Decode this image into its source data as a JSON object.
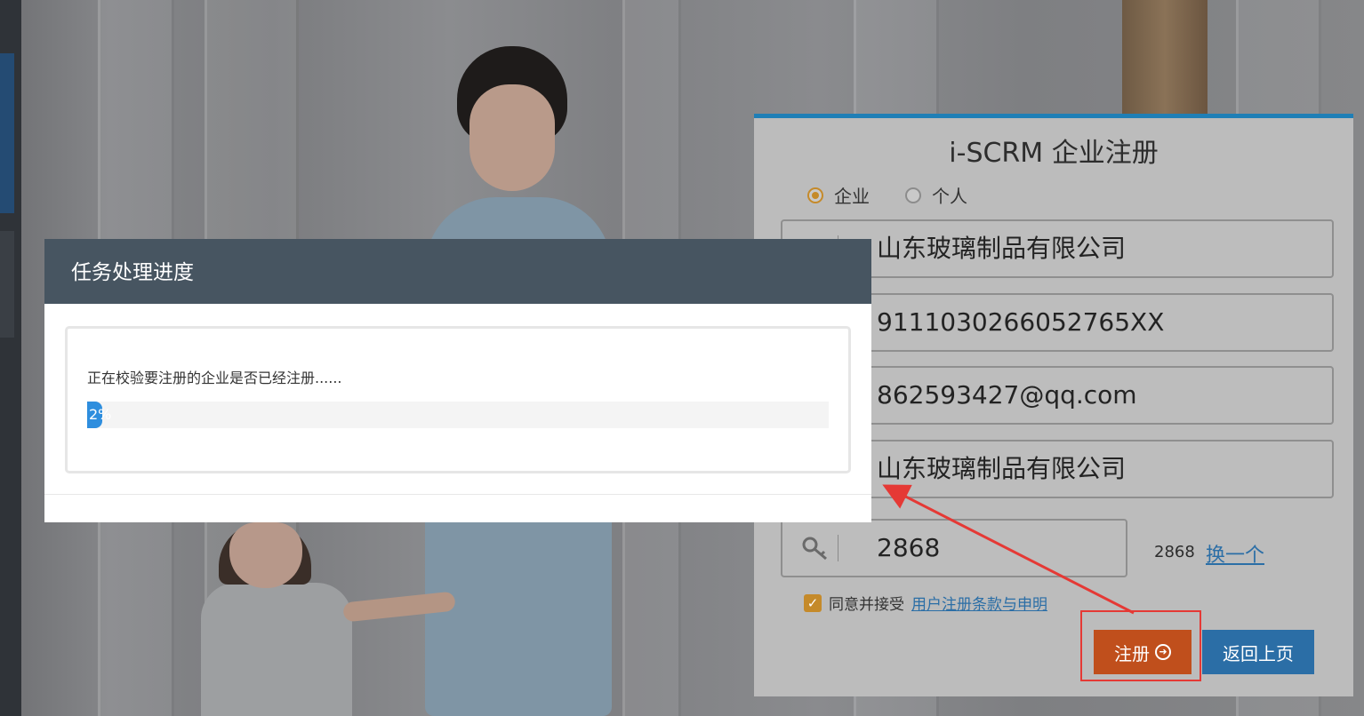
{
  "registration": {
    "title": "i-SCRM 企业注册",
    "type_options": [
      {
        "label": "企业",
        "selected": true
      },
      {
        "label": "个人",
        "selected": false
      }
    ],
    "fields": {
      "company_name": "山东玻璃制品有限公司",
      "credit_code": "9111030266052765XX",
      "email": "862593427@qq.com",
      "contact": "山东玻璃制品有限公司"
    },
    "captcha": {
      "input_value": "2868",
      "code_display": "2868",
      "refresh_label": "换一个"
    },
    "agreement": {
      "checked": true,
      "text": "同意并接受",
      "link_label": "用户注册条款与申明"
    },
    "register_button": "注册",
    "back_button": "返回上页"
  },
  "dialog": {
    "title": "任务处理进度",
    "message": "正在校验要注册的企业是否已经注册......",
    "progress_label": "2%",
    "progress_percent": 2
  },
  "colors": {
    "accent_orange": "#c04f1c",
    "link_blue": "#2b6ea6",
    "progress_blue": "#2e8ede",
    "dialog_header": "#475561",
    "annotation_red": "#e53935"
  }
}
